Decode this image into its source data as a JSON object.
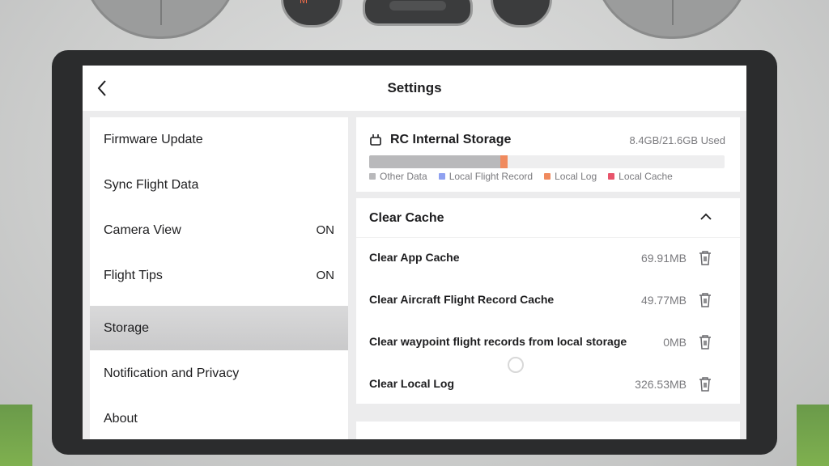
{
  "header": {
    "title": "Settings"
  },
  "menu": {
    "items": [
      {
        "label": "Firmware Update",
        "value": ""
      },
      {
        "label": "Sync Flight Data",
        "value": ""
      },
      {
        "label": "Camera View",
        "value": "ON"
      },
      {
        "label": "Flight Tips",
        "value": "ON"
      },
      {
        "label": "Storage",
        "value": ""
      },
      {
        "label": "Notification and Privacy",
        "value": ""
      },
      {
        "label": "About",
        "value": ""
      }
    ]
  },
  "storage": {
    "title": "RC Internal Storage",
    "used": "8.4GB/21.6GB Used",
    "usage_fraction": {
      "other_data": 0.37,
      "local_log": 0.02
    },
    "legend": [
      {
        "label": "Other Data",
        "color": "#b9b9bb"
      },
      {
        "label": "Local Flight Record",
        "color": "#8fa1f0"
      },
      {
        "label": "Local Log",
        "color": "#f08a5e"
      },
      {
        "label": "Local Cache",
        "color": "#e8546b"
      }
    ]
  },
  "cache": {
    "title": "Clear Cache",
    "rows": [
      {
        "label": "Clear App Cache",
        "size": "69.91MB"
      },
      {
        "label": "Clear Aircraft Flight Record Cache",
        "size": "49.77MB"
      },
      {
        "label": "Clear waypoint flight records from local storage",
        "size": "0MB"
      },
      {
        "label": "Clear Local Log",
        "size": "326.53MB"
      }
    ]
  },
  "controller": {
    "knob_label": "M"
  },
  "icons": {
    "back": "chevron-left-icon",
    "storage": "rc-storage-icon",
    "collapse": "chevron-up-icon",
    "delete": "trash-icon"
  }
}
